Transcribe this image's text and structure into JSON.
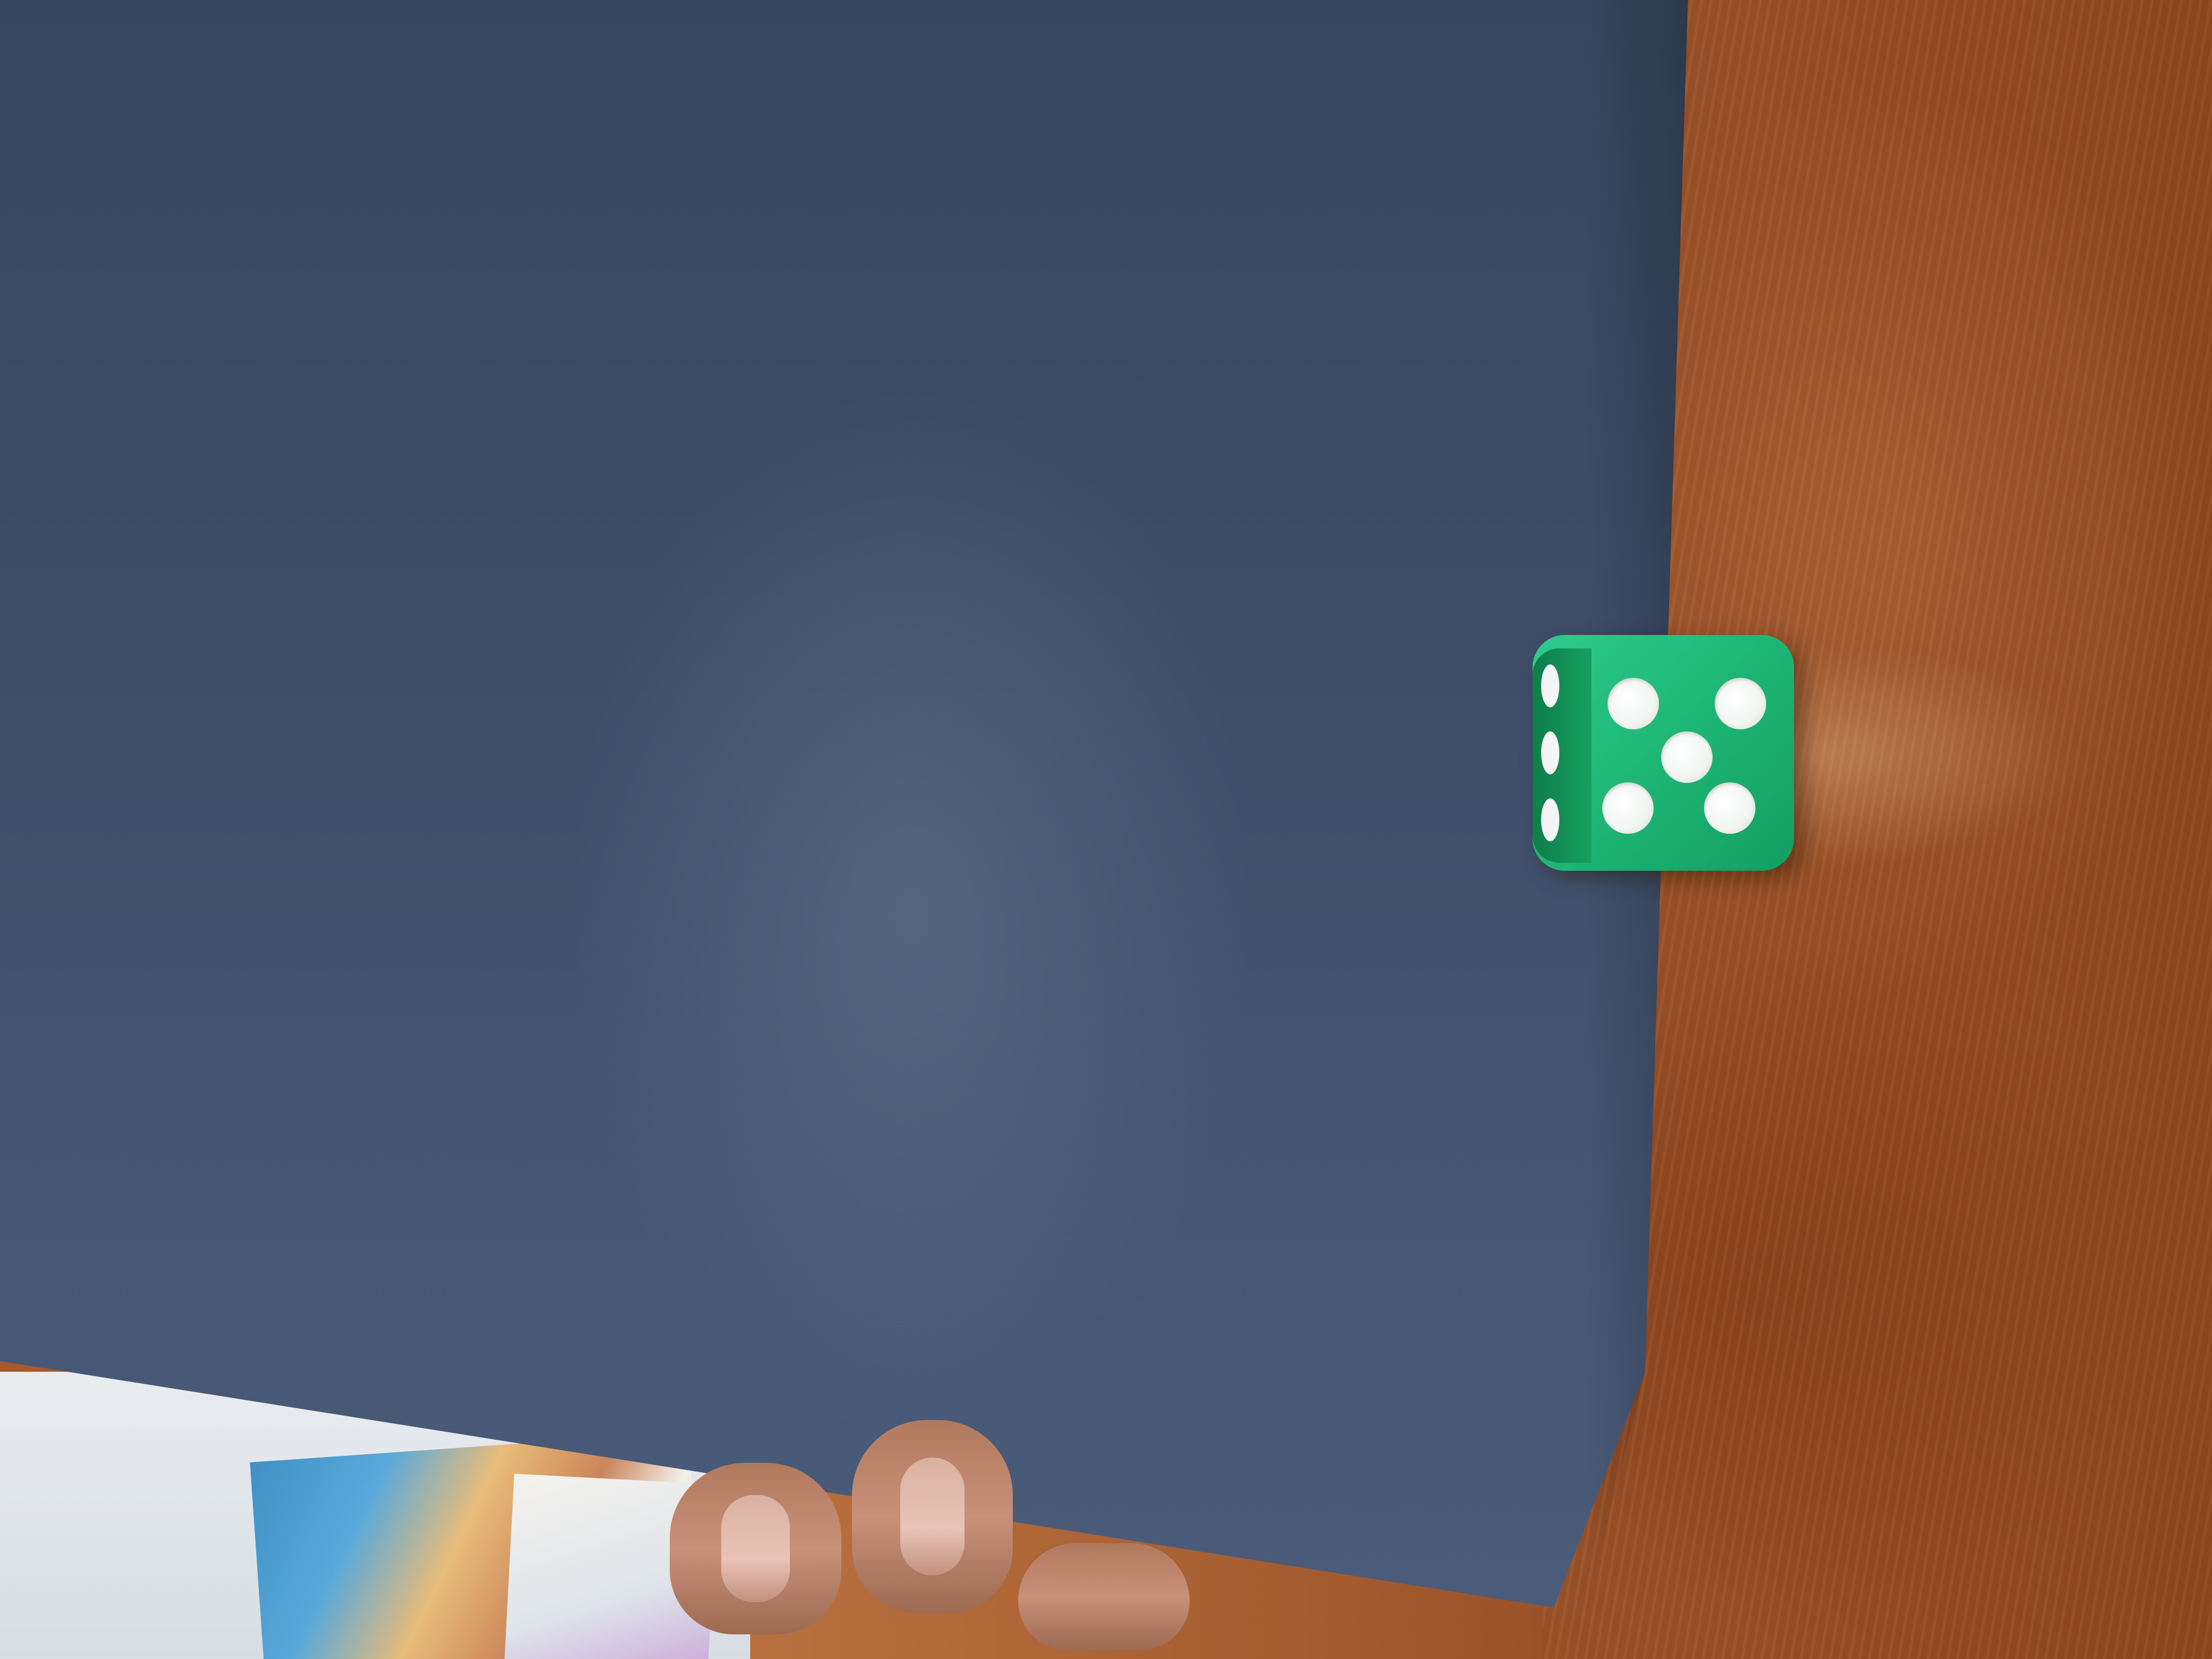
{
  "scene": {
    "subject": "photo",
    "die": {
      "top_face_value": 5,
      "color": "#1fb877",
      "pip_color": "#ffffff"
    },
    "board_color": "#3f4f6a",
    "surface_color": "#a35a2c"
  }
}
